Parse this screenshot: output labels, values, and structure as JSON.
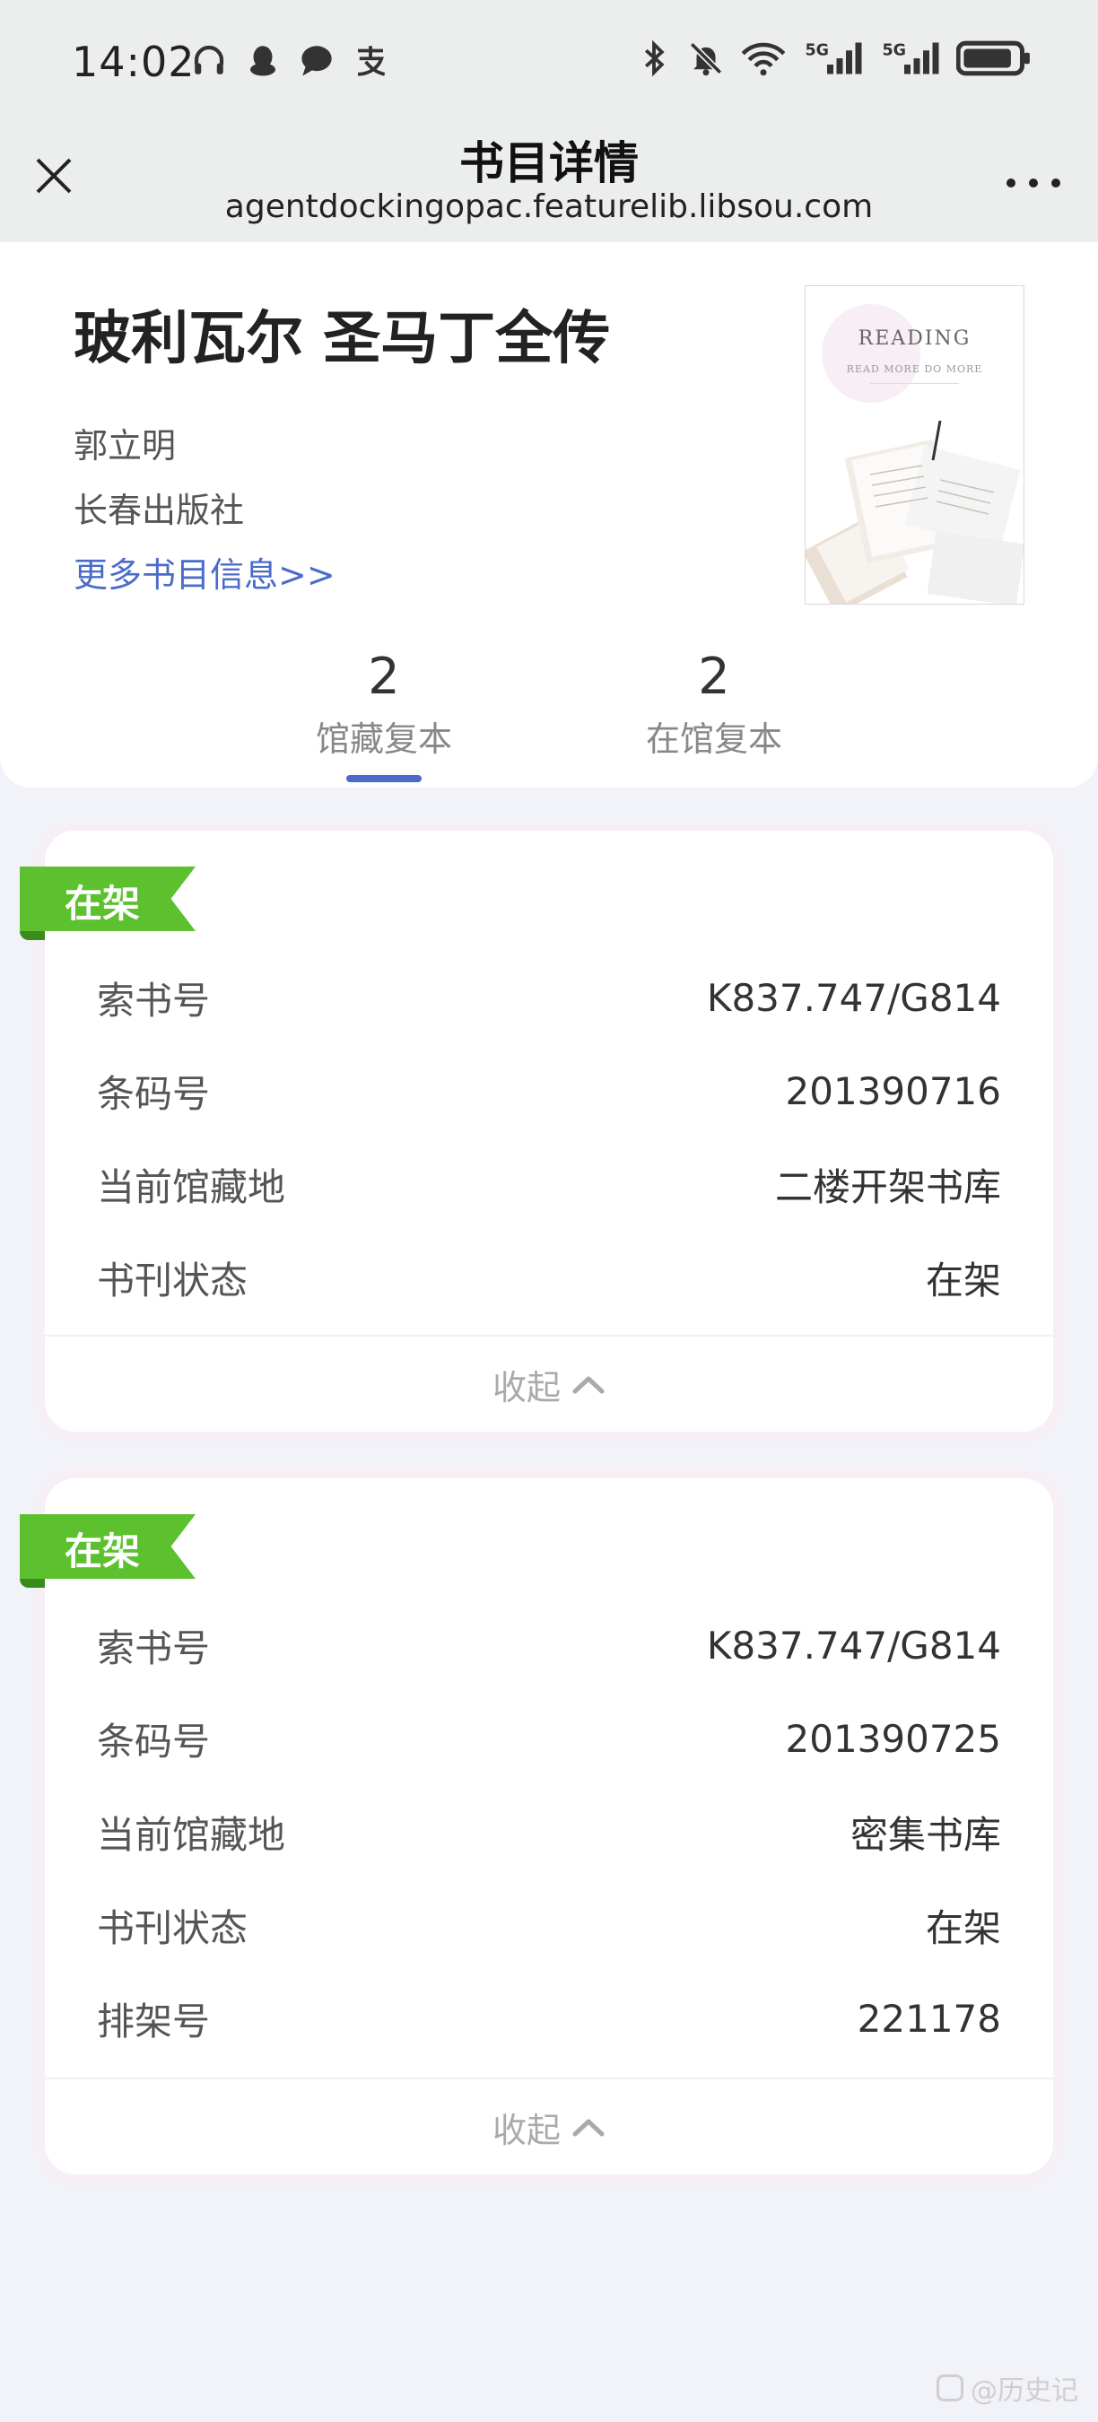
{
  "status_bar": {
    "time": "14:02",
    "left_icons": [
      "headphones-icon",
      "qq-icon",
      "chat-bubble-icon",
      "alipay-icon"
    ],
    "right_icons": [
      "bluetooth-icon",
      "mute-bell-icon",
      "wifi-icon",
      "signal-5g-icon",
      "signal-5g-icon",
      "battery-icon"
    ]
  },
  "title_bar": {
    "title": "书目详情",
    "url": "agentdockingopac.featurelib.libsou.com"
  },
  "book": {
    "title": "玻利瓦尔 圣马丁全传",
    "author": "郭立明",
    "publisher": "长春出版社",
    "more_link": "更多书目信息>>",
    "cover": {
      "title": "READING",
      "subtitle": "READ MORE   DO MORE"
    }
  },
  "stats": [
    {
      "count": "2",
      "label": "馆藏复本",
      "active": true
    },
    {
      "count": "2",
      "label": "在馆复本",
      "active": false
    }
  ],
  "copies": [
    {
      "status_tag": "在架",
      "rows": [
        {
          "label": "索书号",
          "value": "K837.747/G814"
        },
        {
          "label": "条码号",
          "value": "201390716"
        },
        {
          "label": "当前馆藏地",
          "value": "二楼开架书库"
        },
        {
          "label": "书刊状态",
          "value": "在架"
        }
      ],
      "collapse_label": "收起"
    },
    {
      "status_tag": "在架",
      "rows": [
        {
          "label": "索书号",
          "value": "K837.747/G814"
        },
        {
          "label": "条码号",
          "value": "201390725"
        },
        {
          "label": "当前馆藏地",
          "value": "密集书库"
        },
        {
          "label": "书刊状态",
          "value": "在架"
        },
        {
          "label": "排架号",
          "value": "221178"
        }
      ],
      "collapse_label": "收起"
    }
  ],
  "colors": {
    "accent": "#4a6cc8",
    "status_green": "#5cc02f"
  },
  "watermark": "@历史记"
}
